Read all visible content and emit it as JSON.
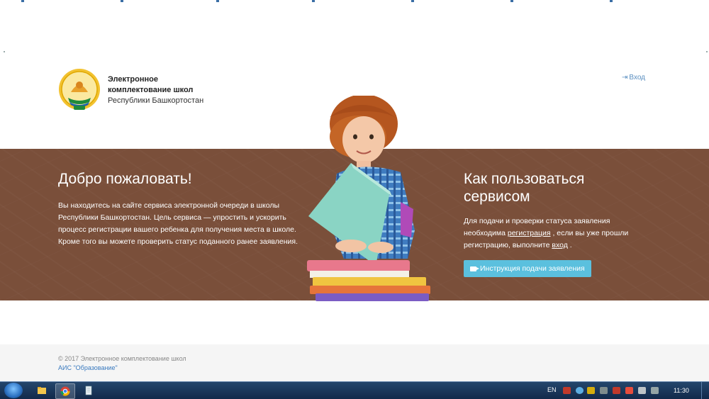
{
  "header": {
    "brand_line1": "Электронное",
    "brand_line2": "комплектование школ",
    "brand_line3": "Республики Башкортостан",
    "login_label": "Вход"
  },
  "hero": {
    "welcome_title": "Добро пожаловать!",
    "welcome_text": "Вы находитесь на сайте сервиса электронной очереди в школы Республики Башкортостан. Цель сервиса — упростить и ускорить процесс регистрации вашего ребенка для получения места в школе. Кроме того вы можете проверить статус поданного ранее заявления.",
    "howto_title": "Как пользоваться сервисом",
    "howto_text_1": "Для подачи и проверки статуса заявления необходима",
    "howto_link_register": "регистрация",
    "howto_text_2": ", если вы уже прошли регистрацию, выполните",
    "howto_link_login": "вход",
    "howto_text_3": ".",
    "instruction_button": "Инструкция подачи заявления"
  },
  "footer": {
    "copyright": "© 2017 Электронное комплектование школ",
    "ais_link": "АИС \"Образование\""
  },
  "taskbar": {
    "language": "EN",
    "clock": "11:30",
    "apps": [
      "explorer-icon",
      "chrome-icon",
      "notepad-icon"
    ]
  },
  "colors": {
    "hero_bg": "#7a4f3a",
    "button_bg": "#5bc0de",
    "link": "#5b8fc1",
    "taskbar": "#1b3759"
  }
}
